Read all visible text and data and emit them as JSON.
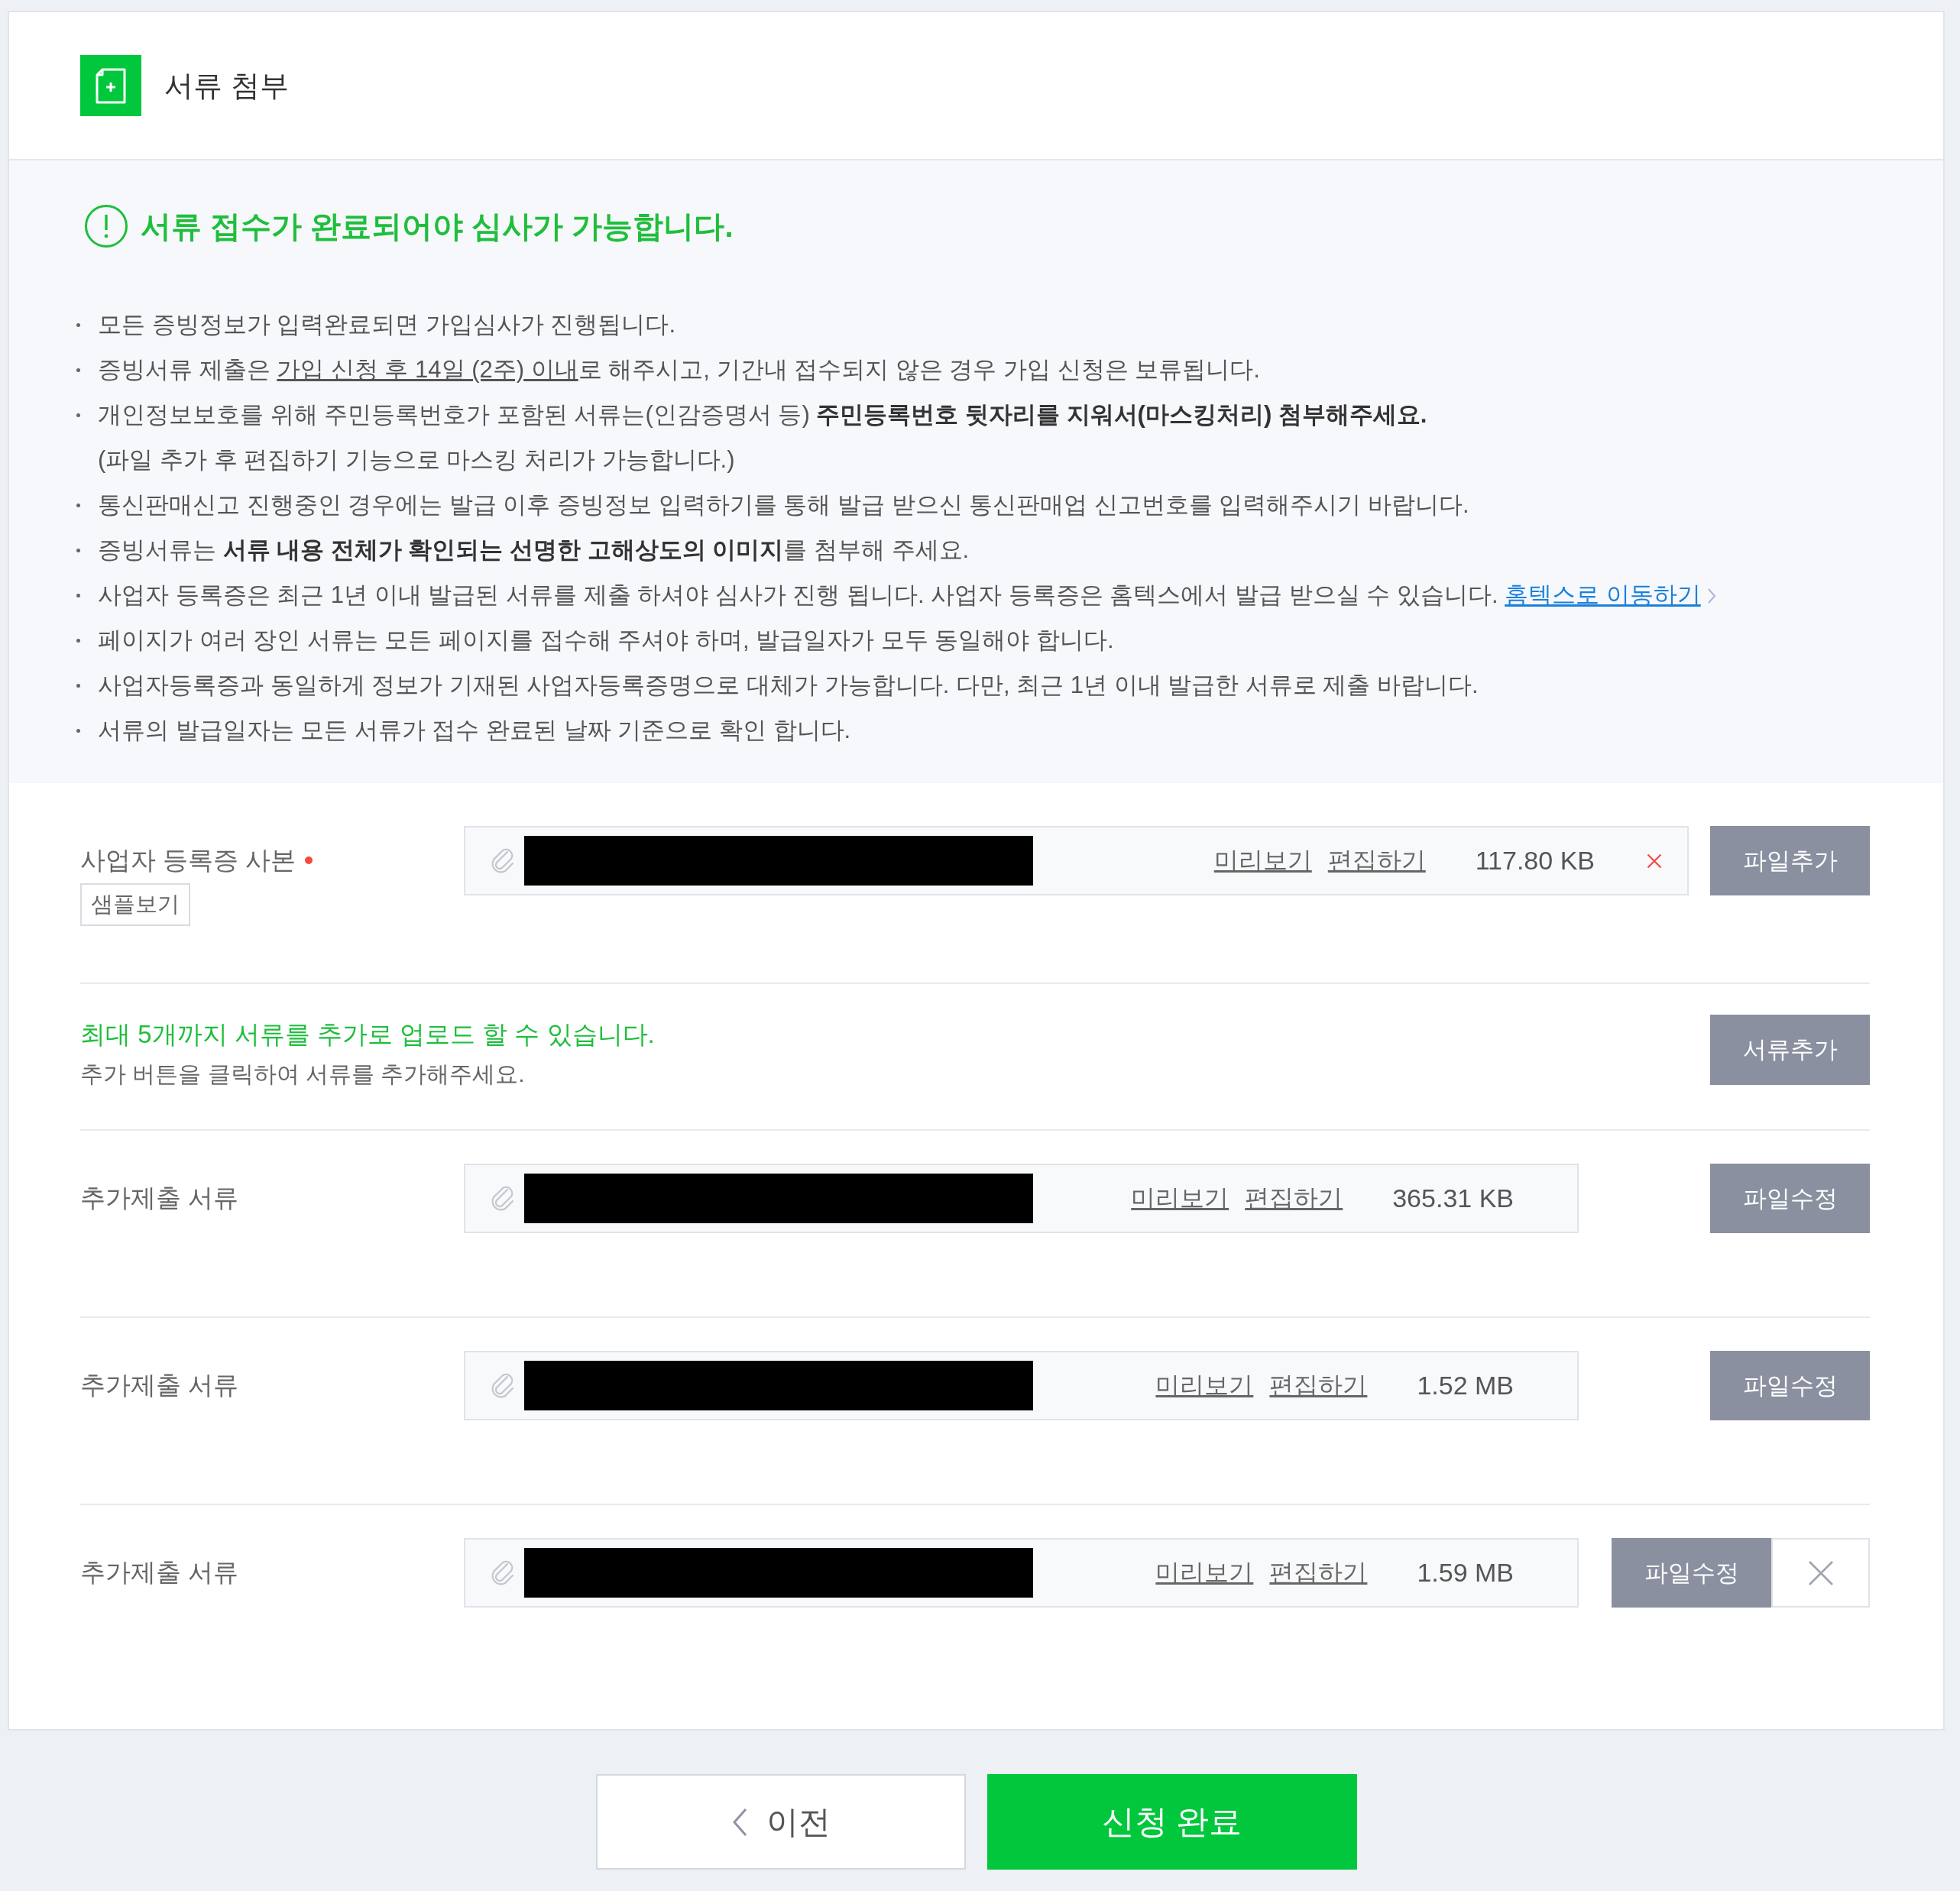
{
  "header": {
    "title": "서류 첨부"
  },
  "notice": {
    "heading": "서류 접수가 완료되어야 심사가 가능합니다.",
    "bullets": [
      {
        "parts": [
          {
            "kind": "text",
            "text": "모든 증빙정보가 입력완료되면 가입심사가 진행됩니다."
          }
        ]
      },
      {
        "parts": [
          {
            "kind": "text",
            "text": "증빙서류 제출은 "
          },
          {
            "kind": "underline",
            "text": "가입 신청 후 14일 (2주) 이내"
          },
          {
            "kind": "text",
            "text": "로 해주시고, 기간내 접수되지 않은 경우 가입 신청은 보류됩니다."
          }
        ]
      },
      {
        "parts": [
          {
            "kind": "text",
            "text": "개인정보보호를 위해 주민등록번호가 포함된 서류는(인감증명서 등) **주민등록번호 뒷자리를 지워서(마스킹처리) 첨부해주세요.**"
          }
        ],
        "note": "(파일 추가 후 편집하기 기능으로 마스킹 처리가 가능합니다.)"
      },
      {
        "parts": [
          {
            "kind": "text",
            "text": "통신판매신고 진행중인 경우에는 발급 이후 증빙정보 입력하기를 통해 발급 받으신 통신판매업 신고번호를 입력해주시기 바랍니다."
          }
        ]
      },
      {
        "parts": [
          {
            "kind": "text",
            "text": "증빙서류는 **서류 내용 전체가 확인되는 선명한 고해상도의 이미지**를 첨부해 주세요."
          }
        ]
      },
      {
        "parts": [
          {
            "kind": "text",
            "text": "사업자 등록증은 최근 1년 이내 발급된 서류를 제출 하셔야 심사가 진행 됩니다. 사업자 등록증은 홈텍스에서 발급 받으실 수 있습니다. "
          },
          {
            "kind": "link",
            "text": "홈텍스로 이동하기"
          }
        ]
      },
      {
        "parts": [
          {
            "kind": "text",
            "text": "페이지가 여러 장인 서류는 모든 페이지를 접수해 주셔야 하며, 발급일자가 모두 동일해야 합니다."
          }
        ]
      },
      {
        "parts": [
          {
            "kind": "text",
            "text": "사업자등록증과 동일하게 정보가 기재된 사업자등록증명으로 대체가 가능합니다. 다만, 최근 1년 이내 발급한 서류로 제출 바랍니다."
          }
        ]
      },
      {
        "parts": [
          {
            "kind": "text",
            "text": "서류의 발급일자는 모든 서류가 접수 완료된 날짜 기준으로 확인 합니다."
          }
        ]
      }
    ]
  },
  "required_document": {
    "label": "사업자 등록증 사본",
    "required": true,
    "sample_button": "샘플보기",
    "file": {
      "preview": "미리보기",
      "edit": "편집하기",
      "size": "117.80 KB",
      "removable": true
    },
    "button": "파일추가"
  },
  "add_more": {
    "notice": "최대 5개까지 서류를 추가로 업로드 할 수 있습니다.",
    "hint": "추가 버튼을 클릭하여 서류를 추가해주세요.",
    "button": "서류추가"
  },
  "additional_documents": [
    {
      "label": "추가제출 서류",
      "required": false,
      "file": {
        "preview": "미리보기",
        "edit": "편집하기",
        "size": "365.31 KB",
        "removable": false
      },
      "button": "파일수정",
      "deletable": false
    },
    {
      "label": "추가제출 서류",
      "required": false,
      "file": {
        "preview": "미리보기",
        "edit": "편집하기",
        "size": "1.52 MB",
        "removable": false
      },
      "button": "파일수정",
      "deletable": false
    },
    {
      "label": "추가제출 서류",
      "required": false,
      "file": {
        "preview": "미리보기",
        "edit": "편집하기",
        "size": "1.59 MB",
        "removable": false
      },
      "button": "파일수정",
      "deletable": true
    }
  ],
  "footer_buttons": [
    {
      "kind": "back",
      "label": "이전"
    },
    {
      "kind": "submit",
      "label": "신청 완료"
    }
  ]
}
